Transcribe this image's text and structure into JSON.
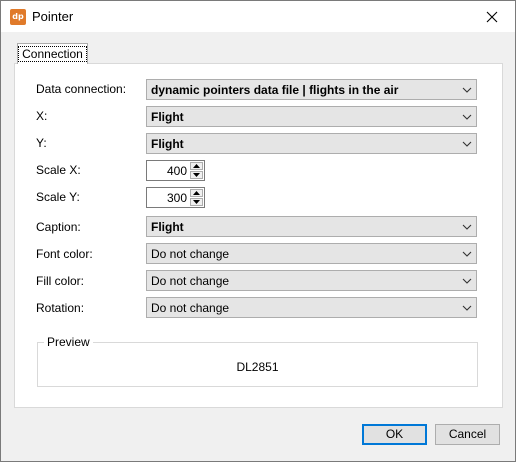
{
  "window": {
    "title": "Pointer",
    "app_icon_text": "dp"
  },
  "tabs": [
    {
      "label": "Connection",
      "selected": true
    }
  ],
  "form": {
    "data_connection": {
      "label": "Data connection:",
      "value": "dynamic pointers data file | flights in the air"
    },
    "x": {
      "label": "X:",
      "value": "Flight"
    },
    "y": {
      "label": "Y:",
      "value": "Flight"
    },
    "scale_x": {
      "label": "Scale X:",
      "value": "400"
    },
    "scale_y": {
      "label": "Scale Y:",
      "value": "300"
    },
    "caption": {
      "label": "Caption:",
      "value": "Flight"
    },
    "font_color": {
      "label": "Font color:",
      "value": "Do not change"
    },
    "fill_color": {
      "label": "Fill color:",
      "value": "Do not change"
    },
    "rotation": {
      "label": "Rotation:",
      "value": "Do not change"
    }
  },
  "preview": {
    "legend": "Preview",
    "text": "DL2851"
  },
  "buttons": {
    "ok": "OK",
    "cancel": "Cancel"
  },
  "colors": {
    "app_icon": "#e07a2a",
    "default_button_border": "#0078d7",
    "window_bg": "#f0f0f0"
  }
}
